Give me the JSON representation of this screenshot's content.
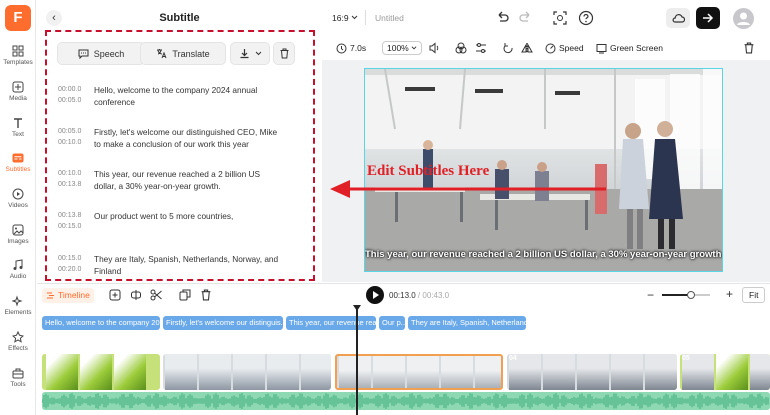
{
  "app": {
    "logo_letter": "F"
  },
  "sidebar": {
    "items": [
      {
        "label": "Templates",
        "icon": "grid-icon"
      },
      {
        "label": "Media",
        "icon": "media-icon"
      },
      {
        "label": "Text",
        "icon": "text-icon"
      },
      {
        "label": "Subtitles",
        "icon": "subtitles-icon",
        "active": true
      },
      {
        "label": "Videos",
        "icon": "video-icon"
      },
      {
        "label": "Images",
        "icon": "image-icon"
      },
      {
        "label": "Audio",
        "icon": "music-icon"
      },
      {
        "label": "Elements",
        "icon": "elements-icon"
      },
      {
        "label": "Effects",
        "icon": "effects-icon"
      },
      {
        "label": "Tools",
        "icon": "toolbox-icon"
      }
    ]
  },
  "panel": {
    "title": "Subtitle",
    "back_glyph": "‹",
    "speech_label": "Speech",
    "translate_label": "Translate",
    "subtitles": [
      {
        "start": "00:00.0",
        "end": "00:05.0",
        "text": "Hello, welcome to the company 2024 annual conference"
      },
      {
        "start": "00:05.0",
        "end": "00:10.0",
        "text": "Firstly, let's welcome our distinguished CEO, Mike to make a conclusion of our work this year"
      },
      {
        "start": "00:10.0",
        "end": "00:13.8",
        "text": "This year, our revenue reached a 2 billion US dollar, a 30% year-on-year growth."
      },
      {
        "start": "00:13.8",
        "end": "00:15.0",
        "text": "Our product went to 5 more countries,"
      },
      {
        "start": "00:15.0",
        "end": "00:20.0",
        "text": "They are Italy, Spanish, Netherlands, Norway, and Finland"
      }
    ]
  },
  "topbar": {
    "aspect_ratio": "16:9",
    "project_name": "Untitled"
  },
  "toolbar2": {
    "duration": "7.0s",
    "zoom": "100%",
    "speed_label": "Speed",
    "green_screen_label": "Green Screen"
  },
  "preview": {
    "caption": "This year, our revenue reached a 2 billion US dollar, a 30% year-on-year growth.",
    "annotation": "Edit Subtitles Here"
  },
  "timeline": {
    "tab_label": "Timeline",
    "current_time": "00:13.0",
    "total_time": "00:43.0",
    "fit_label": "Fit",
    "zoom_level": 0.6,
    "subtitle_chips": [
      "Hello, welcome to the company 20...",
      "Firstly, let's welcome our distinguis...",
      "This year, our revenue rea...",
      "Our p...",
      "They are Italy, Spanish, Netherland..."
    ],
    "clip_badges": [
      "04",
      "05"
    ]
  },
  "colors": {
    "accent": "#ff6d2e",
    "annotation_red": "#e01f26",
    "chip_blue": "#6aa9e9",
    "audio_green": "#8ed8b4"
  }
}
